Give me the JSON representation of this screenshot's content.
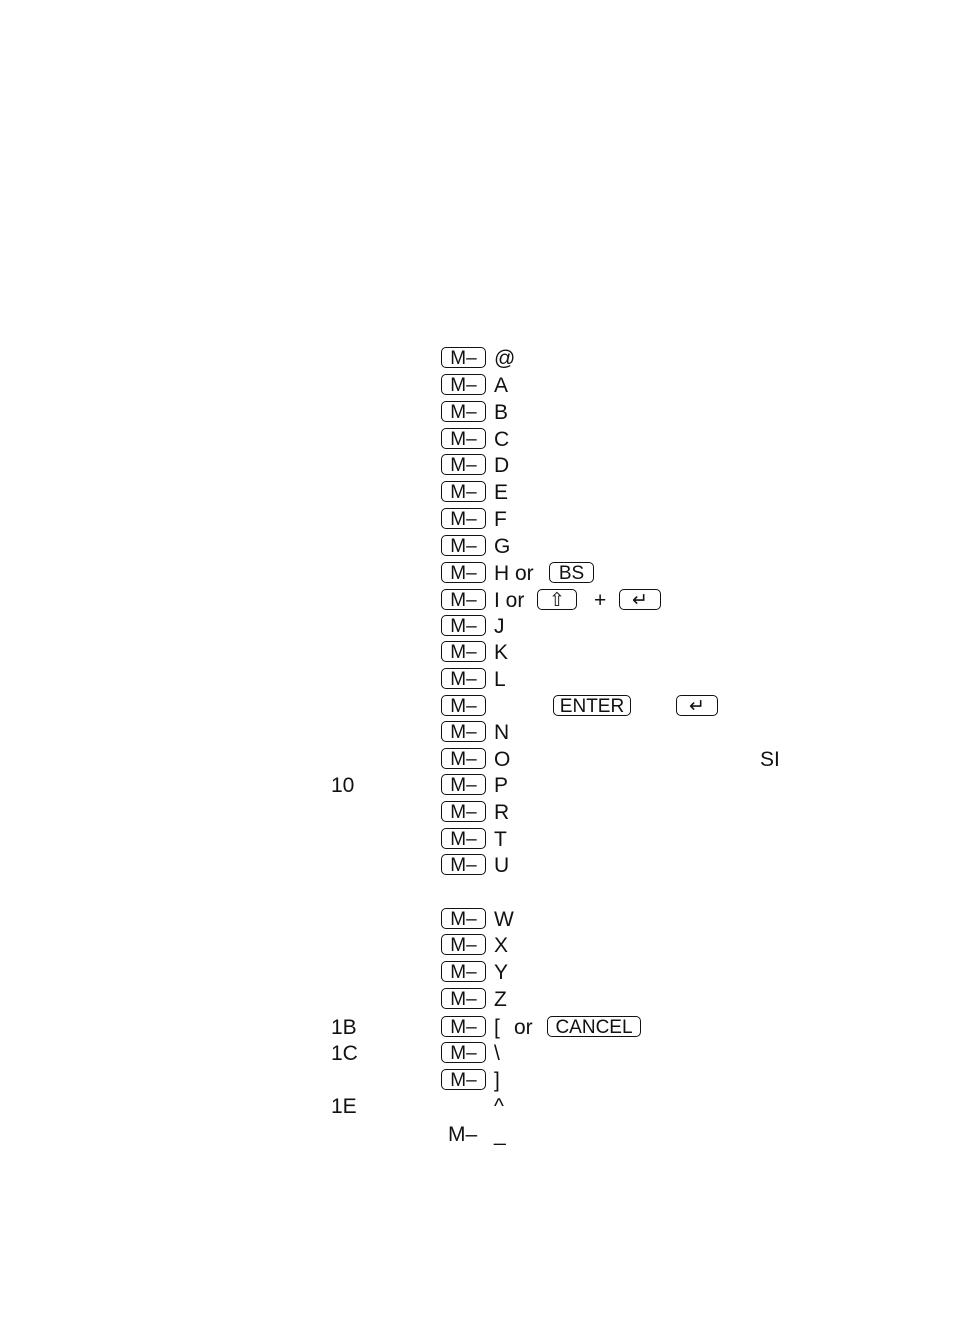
{
  "key_label": "M–",
  "rows": [
    {
      "code": "",
      "key": true,
      "char": "@"
    },
    {
      "code": "",
      "key": true,
      "char": "A"
    },
    {
      "code": "",
      "key": true,
      "char": "B"
    },
    {
      "code": "",
      "key": true,
      "char": "C"
    },
    {
      "code": "",
      "key": true,
      "char": "D"
    },
    {
      "code": "",
      "key": true,
      "char": "E"
    },
    {
      "code": "",
      "key": true,
      "char": "F"
    },
    {
      "code": "",
      "key": true,
      "char": "G"
    },
    {
      "code": "",
      "key": true,
      "char": "H or",
      "extras": [
        {
          "type": "key",
          "label": "BS",
          "icon": ""
        }
      ]
    },
    {
      "code": "",
      "key": true,
      "char": "I or",
      "extras": [
        {
          "type": "key",
          "label": "⇧",
          "icon": "shift-icon"
        },
        {
          "type": "text",
          "label": "+"
        },
        {
          "type": "key",
          "label": "↵",
          "icon": "return-icon"
        }
      ]
    },
    {
      "code": "",
      "key": true,
      "char": "J"
    },
    {
      "code": "",
      "key": true,
      "char": "K"
    },
    {
      "code": "",
      "key": true,
      "char": "L"
    },
    {
      "code": "",
      "key": true,
      "char": "",
      "extras": [
        {
          "type": "key",
          "label": "ENTER",
          "icon": ""
        },
        {
          "type": "key",
          "label": "↵",
          "icon": "return-icon"
        }
      ]
    },
    {
      "code": "",
      "key": true,
      "char": "N"
    },
    {
      "code": "",
      "key": true,
      "char": "O",
      "extras": [
        {
          "type": "text",
          "label": "SI"
        }
      ]
    },
    {
      "code": "10",
      "key": true,
      "char": "P"
    },
    {
      "code": "",
      "key": true,
      "char": "R"
    },
    {
      "code": "",
      "key": true,
      "char": "T"
    },
    {
      "code": "",
      "key": true,
      "char": "U"
    },
    {
      "code": "",
      "key": true,
      "char": "W"
    },
    {
      "code": "",
      "key": true,
      "char": "X"
    },
    {
      "code": "",
      "key": true,
      "char": "Y"
    },
    {
      "code": "",
      "key": true,
      "char": "Z"
    },
    {
      "code": "1B",
      "key": true,
      "char": "[",
      "extras": [
        {
          "type": "text",
          "label": "or"
        },
        {
          "type": "key",
          "label": "CANCEL",
          "icon": ""
        }
      ]
    },
    {
      "code": "1C",
      "key": true,
      "char": "\\"
    },
    {
      "code": "",
      "key": true,
      "char": "]"
    },
    {
      "code": "1E",
      "key": false,
      "char": "^"
    },
    {
      "code": "",
      "key": false,
      "plain": "M–",
      "char": "_"
    }
  ]
}
